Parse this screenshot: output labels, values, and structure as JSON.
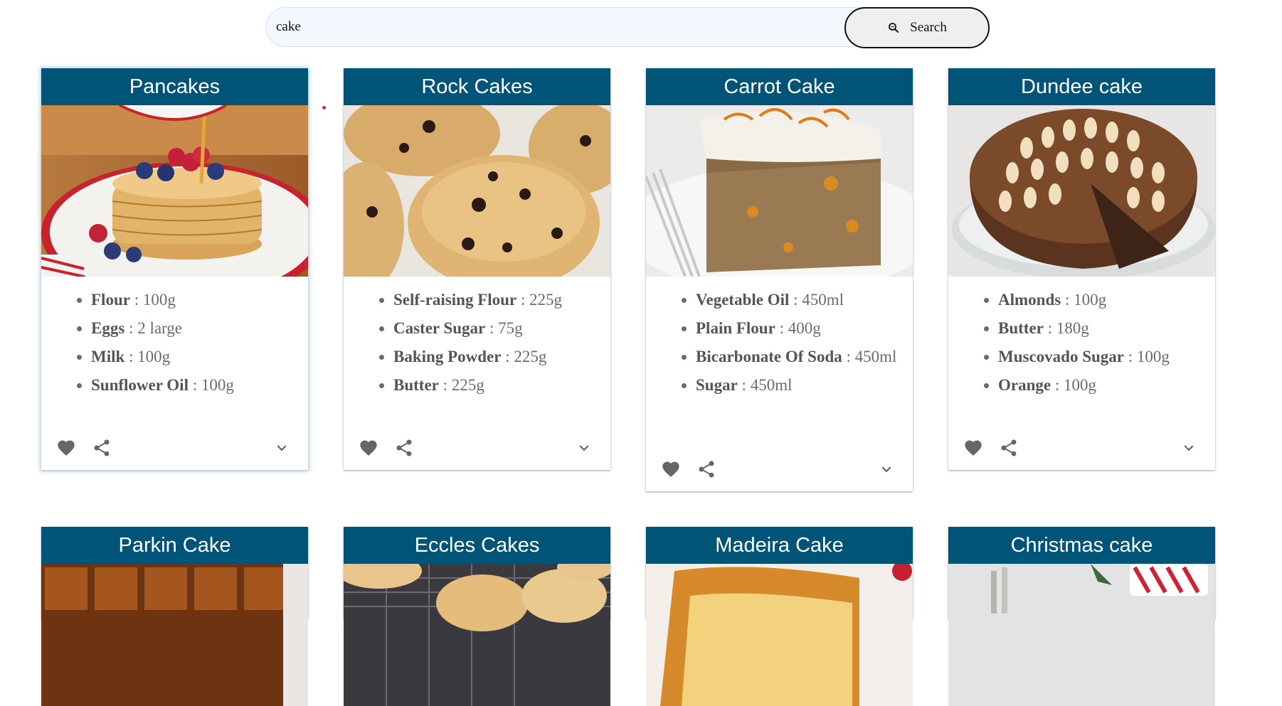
{
  "search": {
    "value": "cake",
    "button_label": "Search"
  },
  "row1": [
    {
      "title": "Pancakes",
      "ingredients": [
        {
          "name": "Flour",
          "qty": "100g"
        },
        {
          "name": "Eggs",
          "qty": "2 large"
        },
        {
          "name": "Milk",
          "qty": "100g"
        },
        {
          "name": "Sunflower Oil",
          "qty": "100g"
        }
      ]
    },
    {
      "title": "Rock Cakes",
      "ingredients": [
        {
          "name": "Self-raising Flour",
          "qty": "225g"
        },
        {
          "name": "Caster Sugar",
          "qty": "75g"
        },
        {
          "name": "Baking Powder",
          "qty": "225g"
        },
        {
          "name": "Butter",
          "qty": "225g"
        }
      ]
    },
    {
      "title": "Carrot Cake",
      "ingredients": [
        {
          "name": "Vegetable Oil",
          "qty": "450ml"
        },
        {
          "name": "Plain Flour",
          "qty": "400g"
        },
        {
          "name": "Bicarbonate Of Soda",
          "qty": "450ml"
        },
        {
          "name": "Sugar",
          "qty": "450ml"
        }
      ]
    },
    {
      "title": "Dundee cake",
      "ingredients": [
        {
          "name": "Almonds",
          "qty": "100g"
        },
        {
          "name": "Butter",
          "qty": "180g"
        },
        {
          "name": "Muscovado Sugar",
          "qty": "100g"
        },
        {
          "name": "Orange",
          "qty": "100g"
        }
      ]
    }
  ],
  "row2": [
    {
      "title": "Parkin Cake"
    },
    {
      "title": "Eccles Cakes"
    },
    {
      "title": "Madeira Cake"
    },
    {
      "title": "Christmas cake"
    }
  ],
  "colors": {
    "header": "#005478",
    "icon": "#666666"
  },
  "icons": [
    "search-icon",
    "heart-icon",
    "share-icon",
    "chevron-down-icon"
  ]
}
